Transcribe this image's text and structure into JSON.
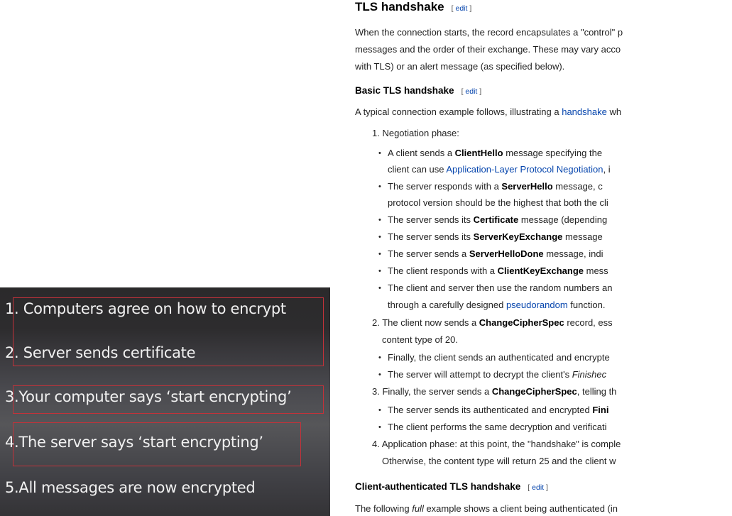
{
  "slide": {
    "items": [
      "1. Computers agree on how to encrypt",
      "2. Server sends certificate",
      "3.Your computer says ‘start encrypting’",
      "4.The server says ‘start encrypting’",
      "5.All messages are now encrypted"
    ],
    "highlight_color": "#c3323a"
  },
  "article": {
    "section_title": "TLS handshake",
    "edit_label": "edit",
    "bracket_open": "[",
    "bracket_close": "]",
    "intro_lines": [
      "When the connection starts, the record encapsulates a \"control\" p",
      "messages and the order of their exchange. These may vary acco",
      "with TLS) or an alert message (as specified below)."
    ],
    "basic_title": "Basic TLS handshake",
    "basic_intro_before": "A typical connection example follows, illustrating a ",
    "basic_intro_link": "handshake",
    "basic_intro_after": " wh",
    "step1": "1. Negotiation phase:",
    "b1_pre": "A client sends a ",
    "b1_bold": "ClientHello",
    "b1_post": " message specifying the",
    "b1_l2_pre": "client can use ",
    "b1_l2_link": "Application-Layer Protocol Negotiation",
    "b1_l2_post": ", i",
    "b2_pre": "The server responds with a ",
    "b2_bold": "ServerHello",
    "b2_post": " message, c",
    "b2_l2": "protocol version should be the highest that both the cli",
    "b3_pre": "The server sends its ",
    "b3_bold": "Certificate",
    "b3_post": " message (depending",
    "b4_pre": "The server sends its ",
    "b4_bold": "ServerKeyExchange",
    "b4_post": " message",
    "b5_pre": "The server sends a ",
    "b5_bold": "ServerHelloDone",
    "b5_post": " message, indi",
    "b6_pre": "The client responds with a ",
    "b6_bold": "ClientKeyExchange",
    "b6_post": " mess",
    "b7": "The client and server then use the random numbers an",
    "b7_l2_pre": "through a carefully designed ",
    "b7_l2_link": "pseudorandom",
    "b7_l2_post": " function.",
    "step2_pre": "2. The client now sends a ",
    "step2_bold": "ChangeCipherSpec",
    "step2_post": " record, ess",
    "step2_l2": "content type of 20.",
    "s2b1": "Finally, the client sends an authenticated and encrypte",
    "s2b2_pre": "The server will attempt to decrypt the client's ",
    "s2b2_ital": "Finishec",
    "step3_pre": "3. Finally, the server sends a ",
    "step3_bold": "ChangeCipherSpec",
    "step3_post": ", telling th",
    "s3b1_pre": "The server sends its authenticated and encrypted ",
    "s3b1_bold": "Fini",
    "s3b2": "The client performs the same decryption and verificati",
    "step4": "4. Application phase: at this point, the \"handshake\" is comple",
    "step4_l2": "Otherwise, the content type will return 25 and the client w",
    "client_auth_title": "Client-authenticated TLS handshake",
    "last_pre": "The following ",
    "last_ital": "full",
    "last_post": " example shows a client being authenticated (in"
  }
}
